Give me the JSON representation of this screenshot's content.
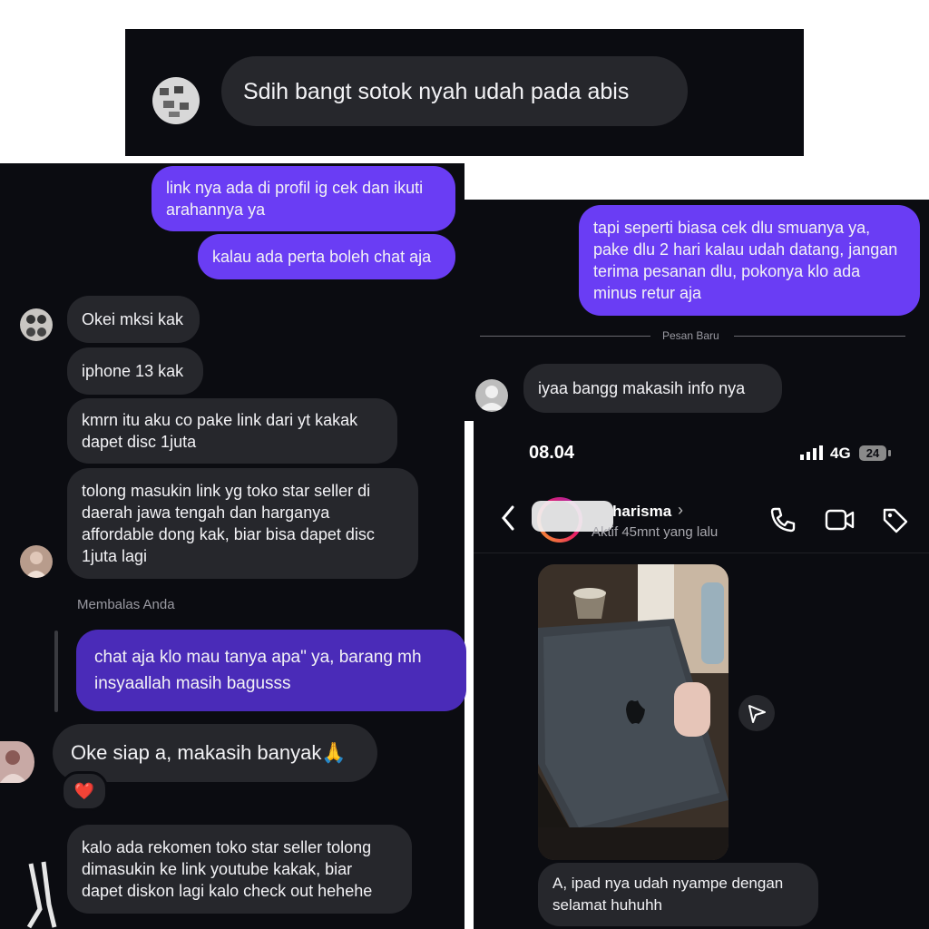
{
  "top": {
    "message": "Sdih bangt sotok nyah udah pada abis"
  },
  "left": {
    "sent1": "link nya ada di profil ig cek dan ikuti arahannya ya",
    "sent2": "kalau ada perta boleh chat aja",
    "recv1": "Okei mksi kak",
    "recv2": "iphone 13 kak",
    "recv3": "kmrn itu aku co pake link dari yt kakak dapet disc 1juta",
    "recv4": "tolong masukin link yg  toko star seller di daerah jawa tengah dan harganya affordable dong kak, biar bisa dapet disc 1juta lagi",
    "reply_label": "Membalas Anda",
    "quoted": "chat aja klo mau tanya apa\" ya, barang mh insyaallah masih bagusss",
    "reply": "Oke siap a, makasih banyak🙏",
    "reaction": "❤️",
    "recv5": "kalo ada rekomen toko star seller tolong dimasukin ke link youtube kakak, biar dapet diskon lagi kalo check out hehehe"
  },
  "right": {
    "sent": "tapi seperti biasa cek dlu smuanya ya, pake dlu 2 hari kalau udah datang, jangan terima pesanan dlu, pokonya klo ada minus retur aja",
    "divider": "Pesan Baru",
    "recv": "iyaa bangg makasih info nya"
  },
  "phone": {
    "time": "08.04",
    "network": "4G",
    "battery": "24",
    "contact_name": "harisma",
    "status": "Aktif 45mnt yang lalu",
    "caption": "A, ipad nya udah nyampe dengan selamat huhuhh"
  },
  "colors": {
    "panel": "#0b0c11",
    "incoming": "#26272c",
    "outgoing": "#6a3df4",
    "quoted": "#4a2bb8"
  }
}
